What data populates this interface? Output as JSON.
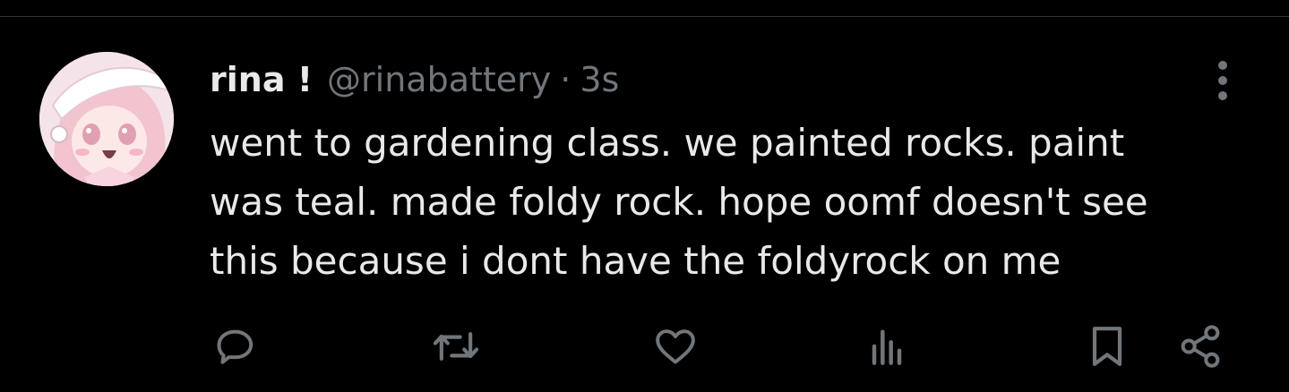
{
  "tweet": {
    "author": {
      "display_name": "rina !",
      "handle": "@rinabattery"
    },
    "separator": "·",
    "timestamp": "3s",
    "text": "went to gardening class. we painted rocks. paint\nwas teal. made foldy rock. hope oomf doesn't see\nthis because i dont have the foldyrock on me"
  },
  "actions": [
    {
      "name": "reply",
      "icon": "speech-bubble-icon"
    },
    {
      "name": "retweet",
      "icon": "retweet-arrows-icon"
    },
    {
      "name": "like",
      "icon": "heart-icon"
    },
    {
      "name": "views",
      "icon": "bar-chart-icon"
    },
    {
      "name": "bookmark",
      "icon": "bookmark-icon"
    },
    {
      "name": "share",
      "icon": "share-nodes-icon"
    }
  ],
  "colors": {
    "background": "#000000",
    "text_primary": "#e7e9ea",
    "text_secondary": "#71767b",
    "divider": "#2f3336"
  }
}
